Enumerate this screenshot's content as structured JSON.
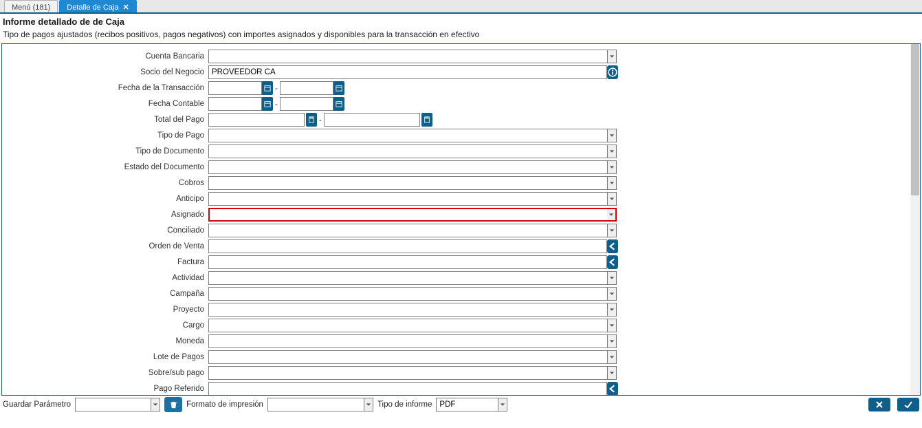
{
  "tabs": {
    "menu": "Menú (181)",
    "active": "Detalle de Caja"
  },
  "header": {
    "title": "Informe detallado de de Caja",
    "subtitle": "Tipo de pagos ajustados (recibos positivos, pagos negativos) con importes asignados y disponibles para la transacción en efectivo"
  },
  "labels": {
    "cuenta_bancaria": "Cuenta Bancaria",
    "socio_negocio": "Socio del Negocio",
    "fecha_transaccion": "Fecha de la Transacción",
    "fecha_contable": "Fecha Contable",
    "total_pago": "Total del Pago",
    "tipo_pago": "Tipo de Pago",
    "tipo_documento": "Tipo de Documento",
    "estado_documento": "Estado del Documento",
    "cobros": "Cobros",
    "anticipo": "Anticipo",
    "asignado": "Asignado",
    "conciliado": "Conciliado",
    "orden_venta": "Orden de Venta",
    "factura": "Factura",
    "actividad": "Actividad",
    "campana": "Campaña",
    "proyecto": "Proyecto",
    "cargo": "Cargo",
    "moneda": "Moneda",
    "lote_pagos": "Lote de Pagos",
    "sobre_sub_pago": "Sobre/sub pago",
    "pago_referido": "Pago Referido"
  },
  "values": {
    "cuenta_bancaria": "",
    "socio_negocio": "PROVEEDOR CA",
    "fecha_trans_from": "",
    "fecha_trans_to": "",
    "fecha_cont_from": "",
    "fecha_cont_to": "",
    "total_pago_from": "",
    "total_pago_to": "",
    "tipo_pago": "",
    "tipo_documento": "",
    "estado_documento": "",
    "cobros": "",
    "anticipo": "",
    "asignado": "",
    "conciliado": "",
    "orden_venta": "",
    "factura": "",
    "actividad": "",
    "campana": "",
    "proyecto": "",
    "cargo": "",
    "moneda": "",
    "lote_pagos": "",
    "sobre_sub_pago": "",
    "pago_referido": ""
  },
  "footer": {
    "guardar_parametro": "Guardar Parámetro",
    "guardar_parametro_value": "",
    "formato_impresion": "Formato de impresión",
    "formato_impresion_value": "",
    "tipo_informe": "Tipo de informe",
    "tipo_informe_value": "PDF"
  },
  "range_sep": "-"
}
